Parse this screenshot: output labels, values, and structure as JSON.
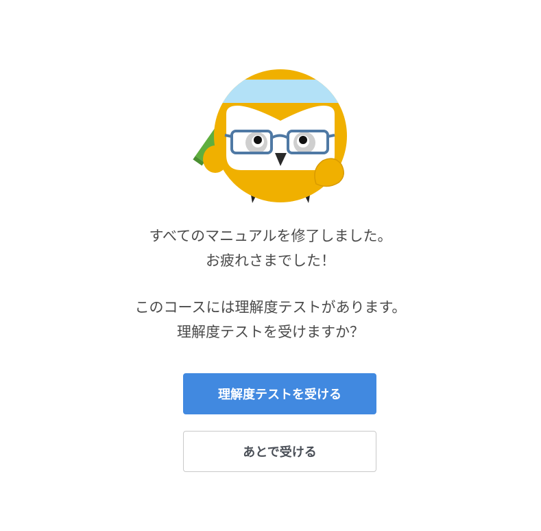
{
  "message": {
    "line1": "すべてのマニュアルを修了しました。",
    "line2": "お疲れさまでした！",
    "line3": "このコースには理解度テストがあります。",
    "line4": "理解度テストを受けますか？"
  },
  "actions": {
    "take_test_label": "理解度テストを受ける",
    "later_label": "あとで受ける"
  },
  "colors": {
    "primary_button": "#4189e0",
    "mascot_body": "#f0b000",
    "headband": "#b3e1f7",
    "glasses": "#4f79a4",
    "pencil": "#5fae3e"
  }
}
